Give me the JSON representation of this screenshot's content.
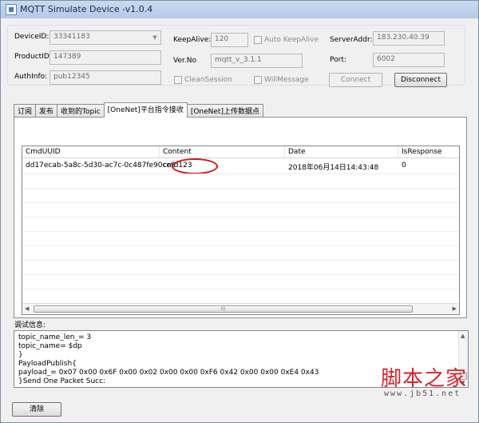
{
  "window": {
    "title": "MQTT Simulate Device  -v1.0.4"
  },
  "connection": {
    "device_id": {
      "label": "DeviceID:",
      "value": "33341183"
    },
    "product_id": {
      "label": "ProductID:",
      "value": "147389"
    },
    "auth_info": {
      "label": "AuthInfo:",
      "value": "pub12345"
    },
    "keep_alive": {
      "label": "KeepAlive:",
      "value": "120"
    },
    "auto_keep_alive": {
      "label": "Auto KeepAlive",
      "checked": false
    },
    "ver_no": {
      "label": "Ver.No",
      "value": "mqtt_v_3.1.1"
    },
    "clean_session": {
      "label": "CleanSession",
      "checked": false
    },
    "will_message": {
      "label": "WillMessage",
      "checked": false
    },
    "server_addr": {
      "label": "ServerAddr:",
      "value": "183.230.40.39"
    },
    "port": {
      "label": "Port:",
      "value": "6002"
    },
    "connect_label": "Connect",
    "disconnect_label": "Disconnect"
  },
  "tabs": [
    {
      "label": "订阅",
      "active": false
    },
    {
      "label": "发布",
      "active": false
    },
    {
      "label": "收到的Topic",
      "active": false
    },
    {
      "label": "[OneNet]平台指令接收",
      "active": true
    },
    {
      "label": "[OneNet]上传数据点",
      "active": false
    }
  ],
  "grid": {
    "columns": [
      "CmdUUID",
      "Content",
      "Date",
      "IsResponse"
    ],
    "rows": [
      {
        "cmd_uuid": "dd17ecab-5a8c-5d30-ac7c-0c487fe90ce8",
        "content": "cmd123",
        "date": "2018年06月14日14:43:48",
        "is_response": "0"
      }
    ],
    "scroll_thumb": "III"
  },
  "debug": {
    "label": "调试信息:",
    "lines": [
      "topic_name_len_= 3",
      "topic_name= $dp",
      "}",
      "PayloadPublish{",
      "payload_= 0x07 0x00 0x6F 0x00 0x02 0x00 0x00 0xF6 0x42 0x00 0x00 0xE4 0x43",
      "}Send One Packet Succ:"
    ]
  },
  "clear_label": "清除",
  "watermark": {
    "text": "脚本之家",
    "url": "www.jb51.net"
  },
  "colors": {
    "annotation": "#d01b1b",
    "watermark": "#d8242a"
  }
}
